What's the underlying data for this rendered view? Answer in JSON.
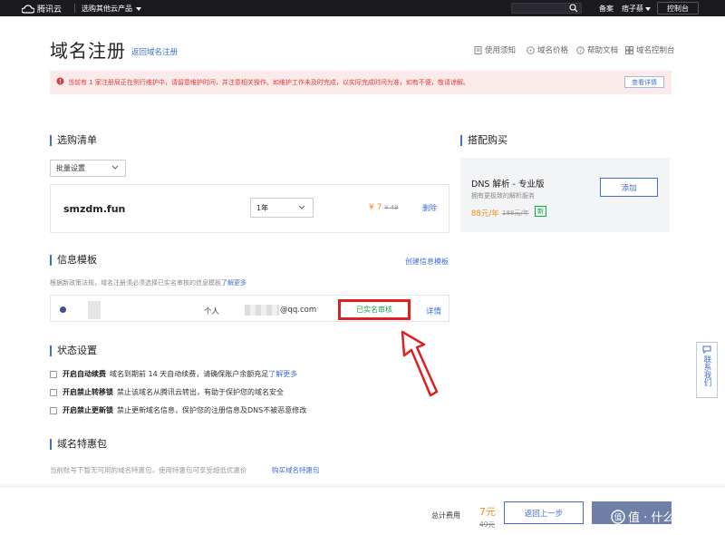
{
  "topbar": {
    "logo_text": "腾讯云",
    "products": "选购其他云产品",
    "beian": "备案",
    "user": "痞子蔡",
    "console": "控制台"
  },
  "header": {
    "title": "域名注册",
    "back_link": "返回域名注册",
    "links": [
      "使用须知",
      "域名价格",
      "帮助文档",
      "域名控制台"
    ]
  },
  "alert": {
    "message": "当前有 1 家注册局正在例行维护中，请留意维护时间，并注意相关操作。如维护工作未及时完成，以实际完成时间为准，如有不便，敬请谅解。",
    "detail_button": "查看详情"
  },
  "cart": {
    "title": "选购清单",
    "batch_select": "批量设置",
    "domain": "smzdm.fun",
    "year": "1年",
    "price": "¥ 7",
    "old_price": "¥ 49",
    "delete": "删除"
  },
  "addon": {
    "title": "搭配购买",
    "name": "DNS 解析 - 专业版",
    "desc": "拥有更极致的解析服务",
    "price": "88元/年",
    "old_price": "188元/年",
    "badge": "新",
    "add_button": "添加"
  },
  "template": {
    "title": "信息模板",
    "create_link": "创建信息模板",
    "note": "根据新政策法规，域名注册须必须选择已实名审核的信息模板",
    "note_link": "了解更多",
    "type": "个人",
    "email_suffix": "@qq.com",
    "status": "已实名审核",
    "detail": "详情"
  },
  "status": {
    "title": "状态设置",
    "options": [
      {
        "label": "开启自动续费",
        "desc": "域名到期前 14 天自动续费，请确保账户余额充足",
        "link": "了解更多"
      },
      {
        "label": "开启禁止转移锁",
        "desc": "禁止该域名从腾讯云转出，有助于保护您的域名安全",
        "link": ""
      },
      {
        "label": "开启禁止更新锁",
        "desc": "禁止更新域名信息，保护您的注册信息及DNS不被恶意修改",
        "link": ""
      }
    ]
  },
  "promo": {
    "title": "域名特惠包",
    "note": "当前账号下暂无可用的域名特惠包，使用特惠包可享受超低优惠价",
    "link": "购买域名特惠包"
  },
  "footer": {
    "total_label": "总计费用",
    "total_price": "7元",
    "total_old": "49元",
    "prev_button": "返回上一步",
    "watermark": "值 · 什么值得买"
  },
  "side_widget": "联系我们",
  "colors": {
    "accent": "#3f6fd0",
    "price": "#f08c1e",
    "alert": "#e03c3c",
    "success": "#1aa34a",
    "highlight": "#e02020"
  }
}
